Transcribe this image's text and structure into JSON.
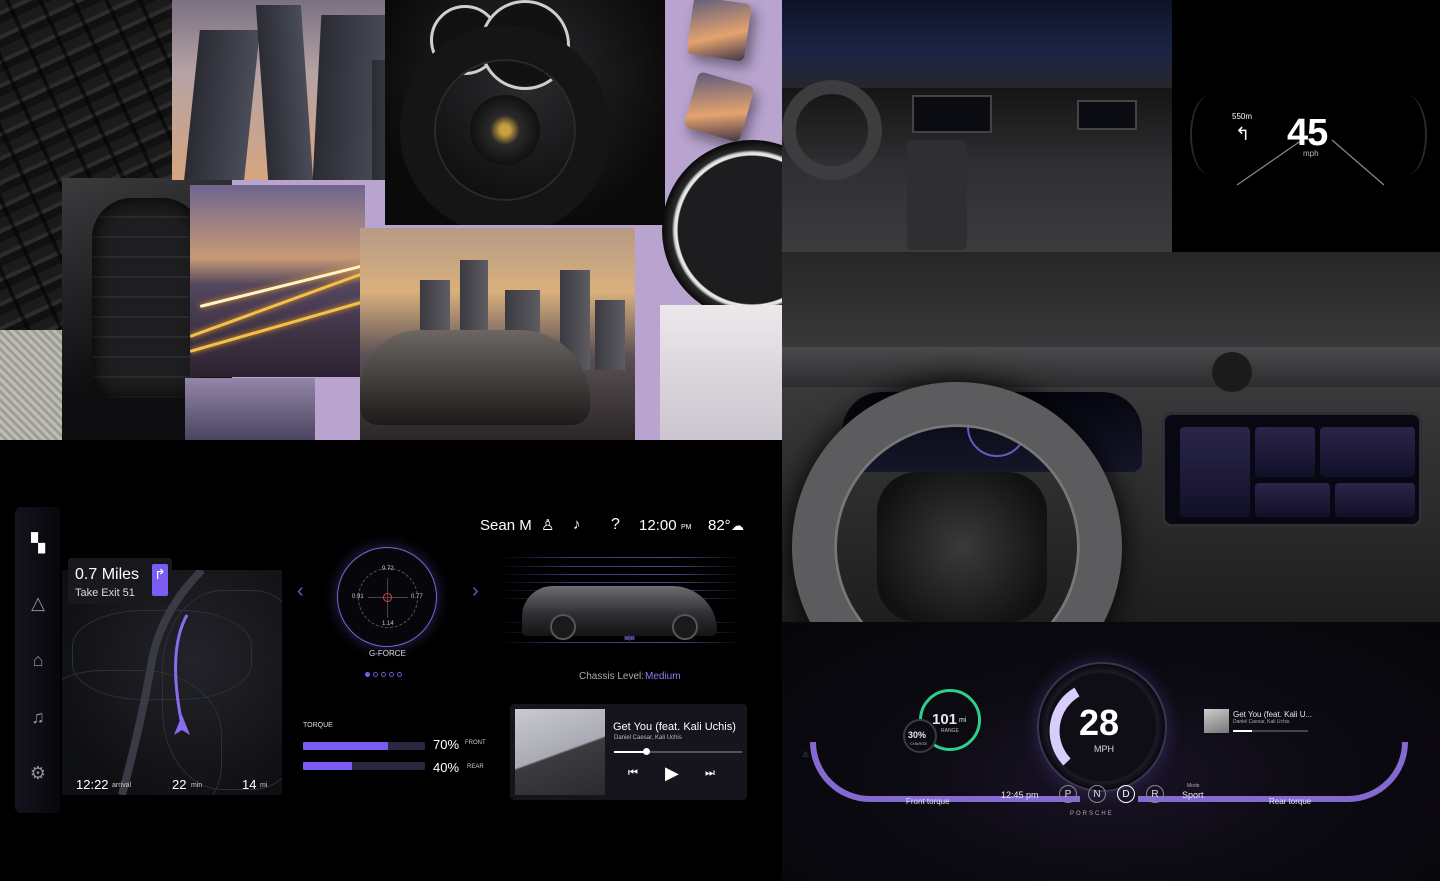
{
  "hud": {
    "distance": "550m",
    "speed": "45",
    "unit": "mph",
    "turn_icon": "turn-left-arrow-icon"
  },
  "cluster": {
    "speed": "28",
    "speed_unit": "MPH",
    "range_value": "101",
    "range_unit": "mi",
    "range_label": "RANGE",
    "charge_value": "30%",
    "charge_label": "CHARGE",
    "time": "12:45 pm",
    "gears": [
      "P",
      "N",
      "D",
      "R"
    ],
    "active_gear": "D",
    "mode_label": "Mode",
    "mode_value": "Sport",
    "front_torque_label": "Front torque",
    "rear_torque_label": "Rear torque",
    "brand": "PORSCHE",
    "song_title": "Get You (feat. Kali U...",
    "song_artist": "Daniel Caesar, Kali Uchis",
    "accent_color": "#9a7cf2",
    "range_color": "#2ecf8b"
  },
  "infotainment": {
    "topbar": {
      "user": "Sean M",
      "time": "12:00",
      "time_suffix": "PM",
      "temperature": "82°"
    },
    "sidebar": [
      "apps-icon",
      "navigation-icon",
      "seat-icon",
      "music-icon",
      "settings-icon"
    ],
    "nav": {
      "distance": "0.7 Miles",
      "instruction": "Take Exit 51",
      "arrival_time": "12:22",
      "arrival_label": "arrival",
      "duration": "22",
      "duration_label": "min",
      "remaining": "14",
      "remaining_label": "mi"
    },
    "gforce": {
      "top": "0.72",
      "left": "0.91",
      "right": "0.77",
      "bottom": "1.14",
      "label": "G-FORCE",
      "page_count": 5,
      "active_page": 1
    },
    "chassis": {
      "label": "Chassis Level:",
      "value": "Medium"
    },
    "torque": {
      "title": "TORQUE",
      "front_percent": "70%",
      "front_label": "FRONT",
      "front_value": 0.7,
      "rear_percent": "40%",
      "rear_label": "REAR",
      "rear_value": 0.4
    },
    "music": {
      "title": "Get You (feat. Kali Uchis)",
      "artist": "Daniel Caesar, Kali Uchis",
      "progress": 0.25
    },
    "accent_color": "#7a5cf0"
  }
}
